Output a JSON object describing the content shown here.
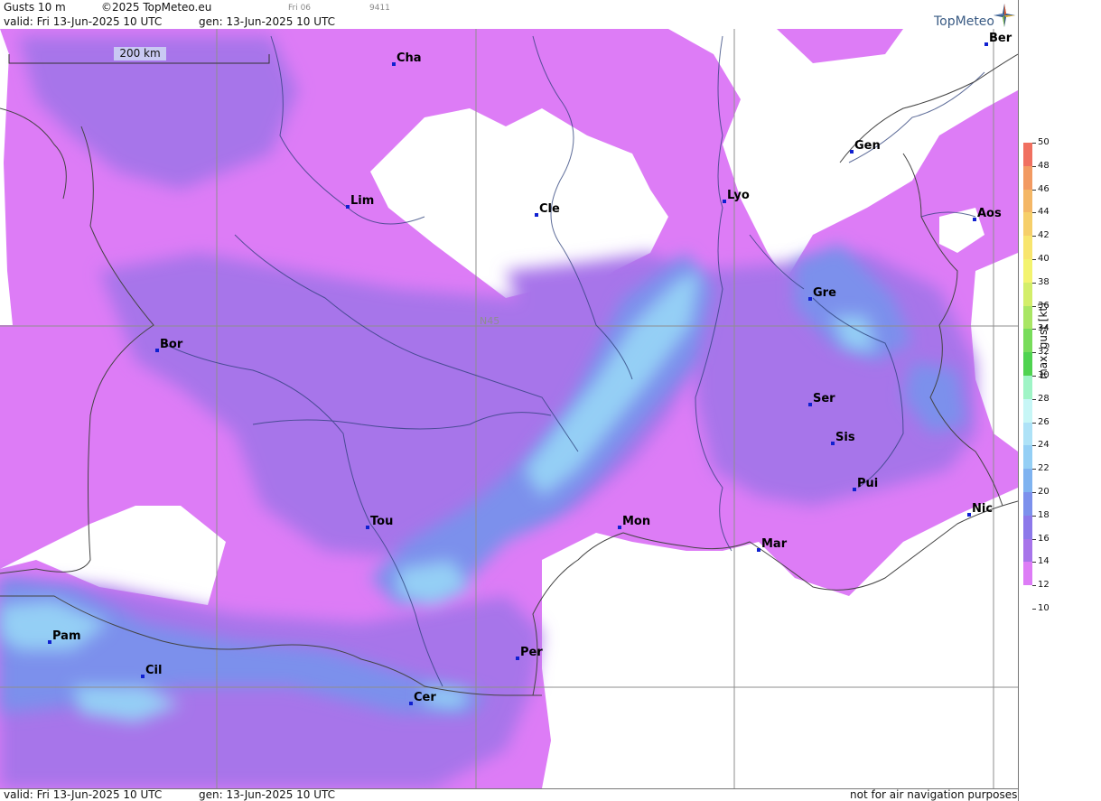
{
  "header": {
    "product": "Gusts 10 m",
    "copyright": "©2025 TopMeteo.eu",
    "run_small": "Fri 06",
    "code_small": "9411",
    "valid": "valid:  Fri  13-Jun-2025  10 UTC",
    "gen": "gen: 13-Jun-2025 10 UTC"
  },
  "logo": {
    "text": "TopMeteo"
  },
  "scale_bar": {
    "label": "200 km"
  },
  "grid_label": "N45",
  "cities": [
    {
      "name": "Cha"
    },
    {
      "name": "Ber"
    },
    {
      "name": "Gen"
    },
    {
      "name": "Lim"
    },
    {
      "name": "Cle"
    },
    {
      "name": "Lyo"
    },
    {
      "name": "Aos"
    },
    {
      "name": "Gre"
    },
    {
      "name": "Bor"
    },
    {
      "name": "Ser"
    },
    {
      "name": "Sis"
    },
    {
      "name": "Pui"
    },
    {
      "name": "Nic"
    },
    {
      "name": "Tou"
    },
    {
      "name": "Mon"
    },
    {
      "name": "Mar"
    },
    {
      "name": "Per"
    },
    {
      "name": "Pam"
    },
    {
      "name": "Cil"
    },
    {
      "name": "Cer"
    }
  ],
  "legend": {
    "title": "max. gust [kt]",
    "ticks": [
      "50",
      "48",
      "46",
      "44",
      "42",
      "40",
      "38",
      "36",
      "34",
      "32",
      "30",
      "28",
      "26",
      "24",
      "22",
      "20",
      "18",
      "16",
      "14",
      "12",
      "10"
    ],
    "colors": {
      "50": "#f07060",
      "48": "#f29a62",
      "46": "#f4b766",
      "44": "#f6cf6a",
      "42": "#f8e56e",
      "40": "#f3f36f",
      "38": "#d3ee6a",
      "36": "#a9e664",
      "34": "#78dc5b",
      "32": "#4fd350",
      "30": "#9ff4c6",
      "28": "#c7f6f6",
      "26": "#aee2f7",
      "24": "#94cff5",
      "22": "#7fb3f0",
      "20": "#7c90ec",
      "18": "#8c78ea",
      "16": "#a774ea",
      "14": "#dd7cf6"
    }
  },
  "footer": {
    "valid": "valid:  Fri  13-Jun-2025  10 UTC",
    "gen": "gen: 13-Jun-2025 10 UTC",
    "note": "not for air navigation purposes"
  }
}
